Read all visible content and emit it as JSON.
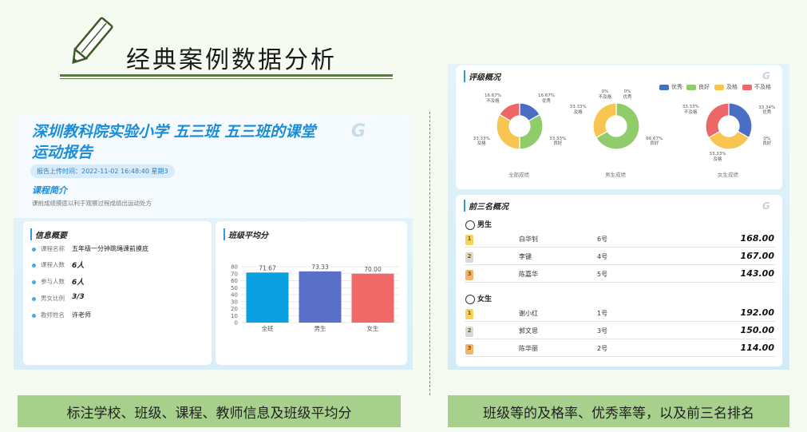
{
  "slide": {
    "title": "经典案例数据分析",
    "caption_left": "标注学校、班级、课程、教师信息及班级平均分",
    "caption_right": "班级等的及格率、优秀率等，以及前三名排名"
  },
  "report": {
    "title": "深圳教科院实验小学 五三班 五三班的课堂运动报告",
    "upload_time": "报告上传时间：2022-11-02 16:48:40 星期3",
    "course_section_title": "课程简介",
    "course_desc": "课前成绩摸底以利于观察过程成绩出运动处方",
    "logo": "G"
  },
  "info": {
    "title": "信息概要",
    "rows": [
      {
        "label": "课程名称",
        "value": "五年级一分钟跳绳课前摸底"
      },
      {
        "label": "课程人数",
        "value": "6人"
      },
      {
        "label": "参与人数",
        "value": "6人"
      },
      {
        "label": "男女比例",
        "value": "3/3"
      },
      {
        "label": "教师姓名",
        "value": "许老师"
      }
    ]
  },
  "avg": {
    "title": "班级平均分"
  },
  "chart_data": [
    {
      "type": "bar",
      "title": "班级平均分",
      "categories": [
        "全班",
        "男生",
        "女生"
      ],
      "values": [
        71.67,
        73.33,
        70.0
      ],
      "value_labels": [
        "71.67",
        "73.33",
        "70.00"
      ],
      "ylim": [
        0,
        80
      ],
      "yticks": [
        "0",
        "10",
        "20",
        "30",
        "40",
        "50",
        "60",
        "70",
        "80"
      ],
      "colors": [
        "#0aa0e0",
        "#5a6fc8",
        "#f06868"
      ],
      "grid": true
    },
    {
      "type": "pie",
      "title": "全部成绩",
      "slices": [
        {
          "name": "优秀",
          "value": 16.67,
          "label": "16.67%",
          "color": "#4a6ec4"
        },
        {
          "name": "良好",
          "value": 33.33,
          "label": "33.33%",
          "color": "#8fcc6a"
        },
        {
          "name": "及格",
          "value": 33.33,
          "label": "33.33%",
          "color": "#f8c650"
        },
        {
          "name": "不及格",
          "value": 16.67,
          "label": "16.67%",
          "color": "#ee6666"
        }
      ]
    },
    {
      "type": "pie",
      "title": "男生成绩",
      "slices": [
        {
          "name": "优秀",
          "value": 0,
          "label": "0%",
          "color": "#4a6ec4"
        },
        {
          "name": "良好",
          "value": 66.67,
          "label": "66.67%",
          "color": "#8fcc6a"
        },
        {
          "name": "及格",
          "value": 33.33,
          "label": "33.33%",
          "color": "#f8c650"
        },
        {
          "name": "不及格",
          "value": 0,
          "label": "0%",
          "color": "#ee6666"
        }
      ]
    },
    {
      "type": "pie",
      "title": "女生成绩",
      "slices": [
        {
          "name": "优秀",
          "value": 33.34,
          "label": "33.34%",
          "color": "#4a6ec4"
        },
        {
          "name": "良好",
          "value": 0,
          "label": "0%",
          "color": "#8fcc6a"
        },
        {
          "name": "及格",
          "value": 33.33,
          "label": "33.33%",
          "color": "#f8c650"
        },
        {
          "name": "不及格",
          "value": 33.33,
          "label": "33.33%",
          "color": "#ee6666"
        }
      ]
    }
  ],
  "rating": {
    "title": "评级概况",
    "legend": [
      {
        "name": "优秀",
        "color": "#4a6ec4"
      },
      {
        "name": "良好",
        "color": "#8fcc6a"
      },
      {
        "name": "及格",
        "color": "#f8c650"
      },
      {
        "name": "不及格",
        "color": "#ee6666"
      }
    ]
  },
  "top3": {
    "title": "前三名概况",
    "boys_label": "男生",
    "girls_label": "女生",
    "boys": [
      {
        "rank": "1",
        "name": "白华钊",
        "no": "6号",
        "score": "168.00"
      },
      {
        "rank": "2",
        "name": "李键",
        "no": "4号",
        "score": "167.00"
      },
      {
        "rank": "3",
        "name": "陈嘉华",
        "no": "5号",
        "score": "143.00"
      }
    ],
    "girls": [
      {
        "rank": "1",
        "name": "谢小红",
        "no": "1号",
        "score": "192.00"
      },
      {
        "rank": "2",
        "name": "郭文思",
        "no": "3号",
        "score": "150.00"
      },
      {
        "rank": "3",
        "name": "陈华丽",
        "no": "2号",
        "score": "114.00"
      }
    ]
  }
}
